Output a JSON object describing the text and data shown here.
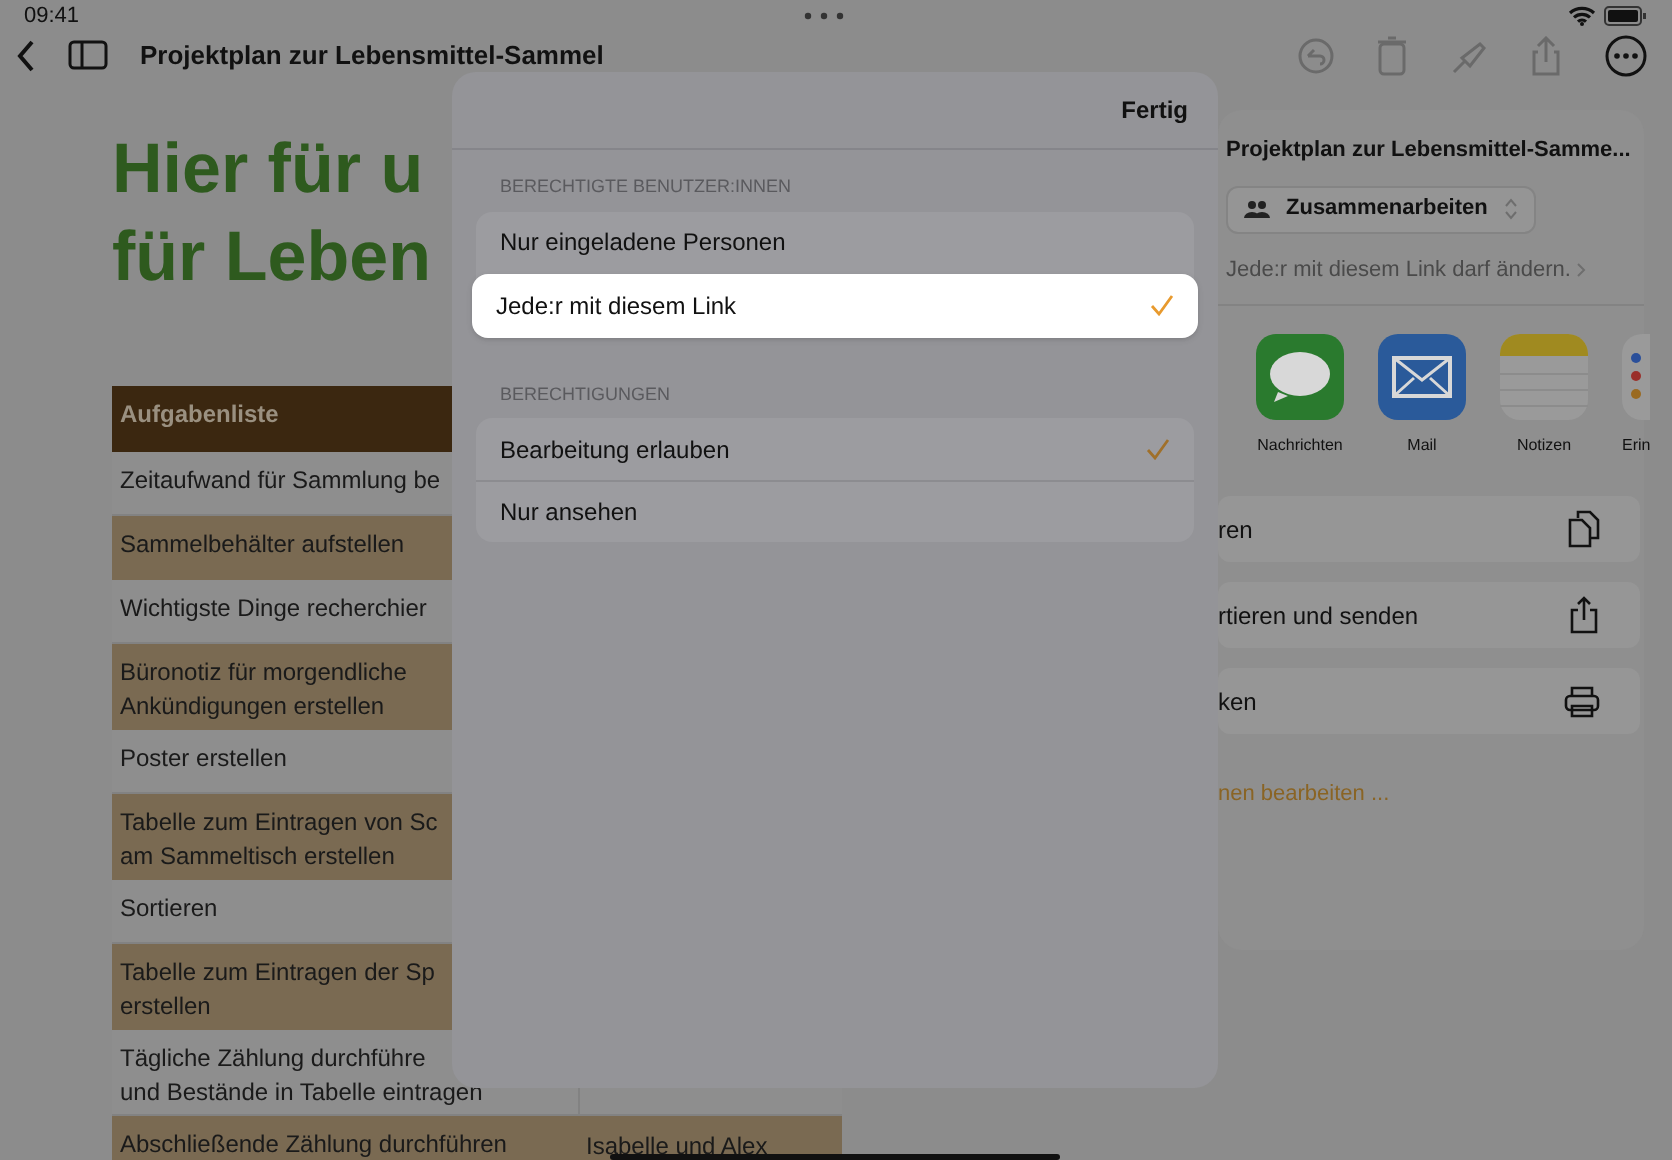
{
  "status_bar": {
    "time": "09:41"
  },
  "toolbar": {
    "title": "Projektplan zur Lebensmittel-Sammel"
  },
  "document": {
    "heading_lines": [
      "Hier für u",
      "für Leben"
    ],
    "table": {
      "header": "Aufgabenliste",
      "rows": [
        {
          "cells": [
            [
              "Zeitaufwand für Sammlung be"
            ]
          ]
        },
        {
          "cells": [
            [
              "Sammelbehälter aufstellen"
            ]
          ]
        },
        {
          "cells": [
            [
              "Wichtigste Dinge recherchier"
            ]
          ]
        },
        {
          "cells": [
            [
              "Büronotiz für morgendliche",
              "Ankündigungen erstellen"
            ]
          ]
        },
        {
          "cells": [
            [
              "Poster erstellen"
            ]
          ]
        },
        {
          "cells": [
            [
              "Tabelle zum Eintragen von Sc",
              "am Sammeltisch erstellen"
            ]
          ]
        },
        {
          "cells": [
            [
              "Sortieren"
            ]
          ]
        },
        {
          "cells": [
            [
              "Tabelle zum Eintragen der Sp",
              "erstellen"
            ]
          ]
        },
        {
          "cells": [
            [
              "Tägliche Zählung durchführe",
              "und Bestände in Tabelle eintragen"
            ]
          ]
        },
        {
          "cells": [
            [
              "Abschließende Zählung durchführen"
            ],
            [
              "Isabelle und Alex"
            ]
          ]
        }
      ]
    }
  },
  "share_sheet": {
    "title": "Projektplan zur Lebensmittel-Samme...",
    "collaboration_button": "Zusammenarbeiten",
    "access_summary": "Jede:r mit diesem Link darf ändern.",
    "apps": [
      {
        "kind": "messages",
        "label": "Nachrichten"
      },
      {
        "kind": "mail",
        "label": "Mail"
      },
      {
        "kind": "notes",
        "label": "Notizen"
      },
      {
        "kind": "reminders",
        "label": "Erin"
      }
    ],
    "actions": [
      {
        "kind": "copy",
        "label": "ren"
      },
      {
        "kind": "export",
        "label": "rtieren und senden"
      },
      {
        "kind": "print",
        "label": "ken"
      }
    ],
    "edit_link": "nen bearbeiten ..."
  },
  "dialog": {
    "done_button": "Fertig",
    "sections": [
      {
        "header": "BERECHTIGTE BENUTZER:INNEN",
        "options": [
          {
            "label": "Nur eingeladene Personen",
            "checked": false,
            "selected": false
          },
          {
            "label": "Jede:r mit diesem Link",
            "checked": true,
            "selected": true
          }
        ]
      },
      {
        "header": "BERECHTIGUNGEN",
        "options": [
          {
            "label": "Bearbeitung erlauben",
            "checked": true,
            "selected": false
          },
          {
            "label": "Nur ansehen",
            "checked": false,
            "selected": false
          }
        ]
      }
    ]
  }
}
